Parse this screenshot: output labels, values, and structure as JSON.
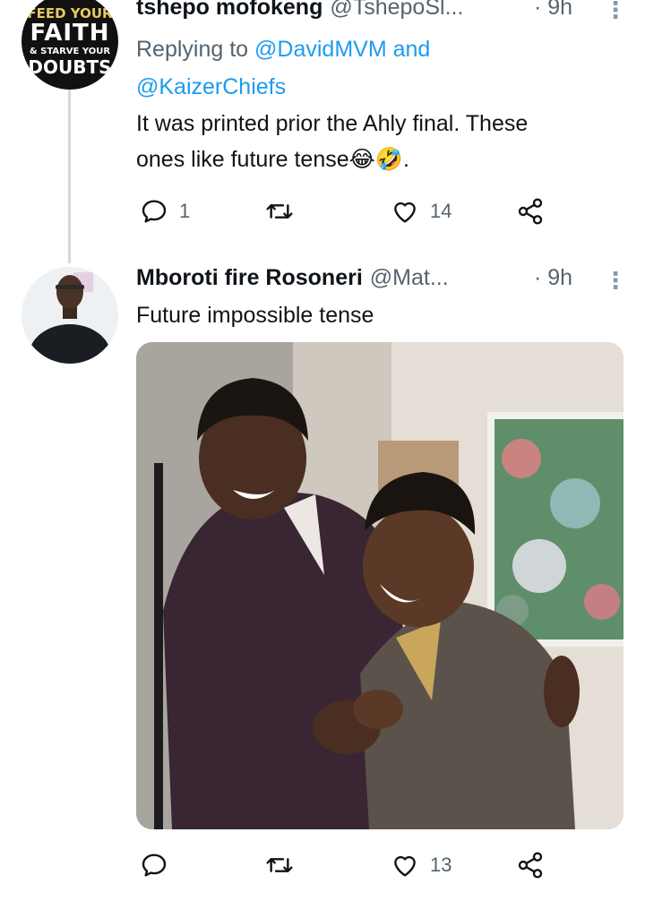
{
  "tweet1": {
    "avatar_text": [
      "FEED YOUR",
      "FAITH",
      "& STARVE YOUR",
      "DOUBTS"
    ],
    "name": "tshepo mofokeng",
    "handle": "@TshepoSl...",
    "time": "· 9h",
    "replying_label": "Replying to",
    "mention1": "@DavidMVM",
    "and_word": "and",
    "mention2": "@KaizerChiefs",
    "text_line1": "It was printed prior the Ahly final. These",
    "text_line2": "ones like future tense😂🤣.",
    "replies": "1",
    "retweets": "",
    "likes": "14"
  },
  "tweet2": {
    "name": "Mboroti fire Rosoneri",
    "handle": "@Mat...",
    "time": "· 9h",
    "text": "Future impossible tense",
    "replies": "",
    "retweets": "",
    "likes": "13"
  },
  "icons": {
    "reply": "reply-icon",
    "retweet": "retweet-icon",
    "like": "heart-icon",
    "share": "share-icon",
    "more": "more-vertical-icon"
  },
  "colors": {
    "text": "#0f1419",
    "muted": "#536471",
    "link": "#1d9bf0",
    "thread_line": "#cfd9de"
  }
}
